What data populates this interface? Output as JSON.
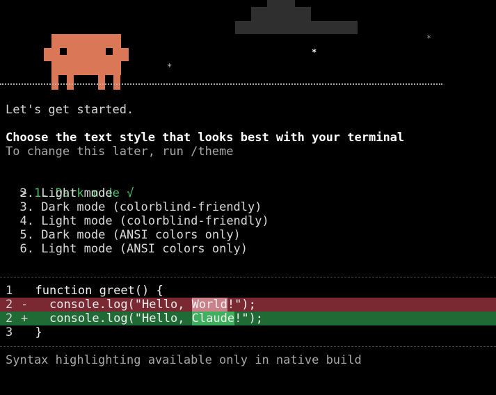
{
  "colors": {
    "mascot": "#d97757",
    "selected": "#4ec26a",
    "diff_removed_bg": "#7a2832",
    "diff_added_bg": "#1f6a35",
    "diff_removed_highlight": "#c9828a",
    "diff_added_highlight": "#3fb05e"
  },
  "decorations": {
    "mascot_icon": "pixel-alien-mascot",
    "cloud_icon": "pixel-cloud",
    "star_glyph": "*"
  },
  "intro": {
    "greeting": "Let's get started.",
    "heading": "Choose the text style that looks best with your terminal",
    "hint": "To change this later, run /theme"
  },
  "theme_menu": {
    "cursor": ">",
    "selected_index": 0,
    "check_mark": "√",
    "options": [
      {
        "number": "1.",
        "label": "Dark mode"
      },
      {
        "number": "2.",
        "label": "Light mode"
      },
      {
        "number": "3.",
        "label": "Dark mode (colorblind-friendly)"
      },
      {
        "number": "4.",
        "label": "Light mode (colorblind-friendly)"
      },
      {
        "number": "5.",
        "label": "Dark mode (ANSI colors only)"
      },
      {
        "number": "6.",
        "label": "Light mode (ANSI colors only)"
      }
    ]
  },
  "diff_preview": {
    "lines": [
      {
        "line_no": "1",
        "marker": " ",
        "code_before": "function greet() {",
        "highlight": "",
        "code_after": ""
      },
      {
        "line_no": "2",
        "marker": "-",
        "code_before": "  console.log(\"Hello, ",
        "highlight": "World",
        "code_after": "!\");"
      },
      {
        "line_no": "2",
        "marker": "+",
        "code_before": "  console.log(\"Hello, ",
        "highlight": "Claude",
        "code_after": "!\");"
      },
      {
        "line_no": "3",
        "marker": " ",
        "code_before": "}",
        "highlight": "",
        "code_after": ""
      }
    ]
  },
  "footer": {
    "note": "Syntax highlighting available only in native build"
  }
}
